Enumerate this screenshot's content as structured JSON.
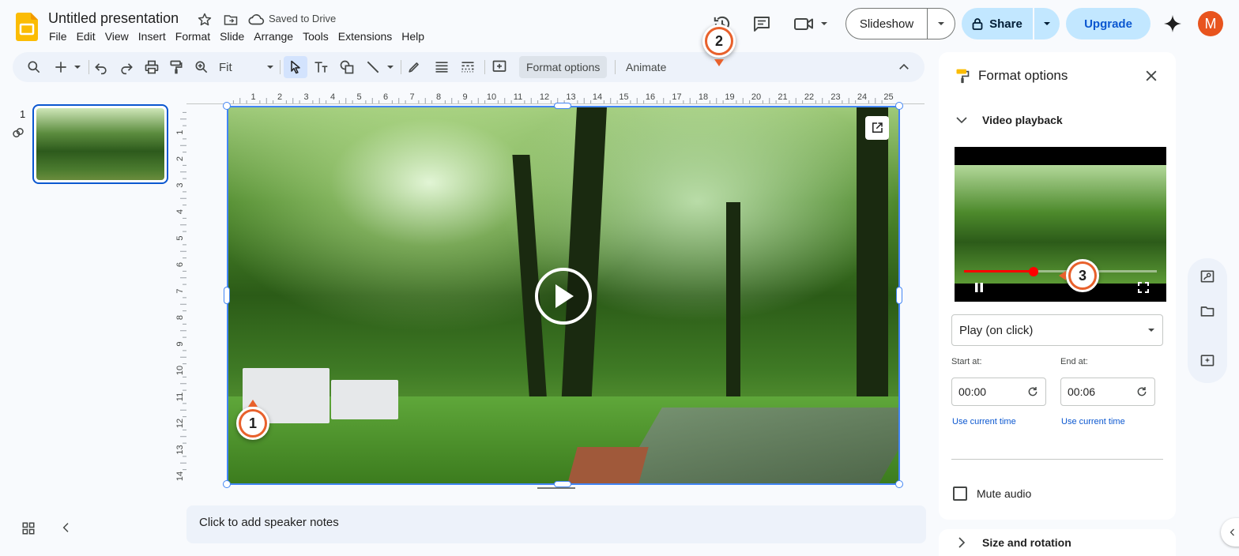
{
  "app": {
    "title": "Untitled presentation",
    "save_status": "Saved to Drive",
    "brand_color": "#fbbc04"
  },
  "menu": [
    "File",
    "Edit",
    "View",
    "Insert",
    "Format",
    "Slide",
    "Arrange",
    "Tools",
    "Extensions",
    "Help"
  ],
  "header_buttons": {
    "slideshow": "Slideshow",
    "share": "Share",
    "upgrade": "Upgrade",
    "avatar_initial": "M"
  },
  "toolbar": {
    "zoom": "Fit",
    "format_options": "Format options",
    "animate": "Animate"
  },
  "filmstrip": {
    "slide_number": "1"
  },
  "ruler": {
    "top_ticks": [
      "1",
      "2",
      "3",
      "4",
      "5",
      "6",
      "7",
      "8",
      "9",
      "10",
      "11",
      "12",
      "13",
      "14",
      "15",
      "16",
      "17",
      "18",
      "19",
      "20",
      "21",
      "22",
      "23",
      "24",
      "25"
    ],
    "left_ticks": [
      "1",
      "2",
      "3",
      "4",
      "5",
      "6",
      "7",
      "8",
      "9",
      "10",
      "11",
      "12",
      "13",
      "14"
    ]
  },
  "notes": {
    "placeholder": "Click to add speaker notes"
  },
  "format_panel": {
    "title": "Format options",
    "section_video": "Video playback",
    "preview_progress": 0.36,
    "playback_mode": "Play (on click)",
    "start_label": "Start at:",
    "start_value": "00:00",
    "end_label": "End at:",
    "end_value": "00:06",
    "use_current_time": "Use current time",
    "mute_label": "Mute audio",
    "mute_checked": false,
    "section_size": "Size and rotation"
  },
  "markers": [
    "1",
    "2",
    "3"
  ],
  "colors": {
    "selection_blue": "#4285f4",
    "accent_blue": "#0b57d0",
    "marker_orange": "#e8612c",
    "avatar_orange": "#e8541e",
    "progress_red": "#ff0000"
  }
}
